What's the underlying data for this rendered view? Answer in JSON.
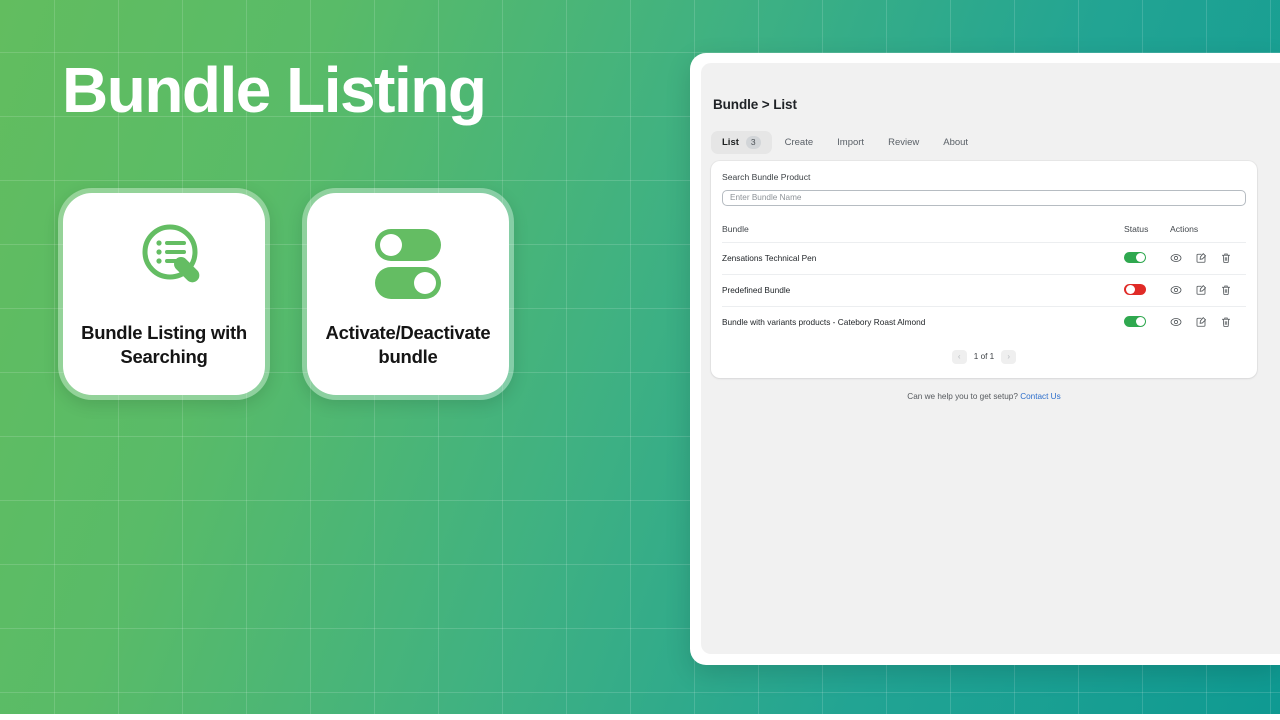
{
  "hero": {
    "title": "Bundle Listing"
  },
  "feature_cards": [
    {
      "icon": "magnifier-list-icon",
      "label": "Bundle Listing with Searching"
    },
    {
      "icon": "toggle-switches-icon",
      "label": "Activate/Deactivate bundle"
    }
  ],
  "app": {
    "breadcrumb": "Bundle > List",
    "tabs": [
      {
        "label": "List",
        "badge": "3",
        "active": true
      },
      {
        "label": "Create",
        "badge": "",
        "active": false
      },
      {
        "label": "Import",
        "badge": "",
        "active": false
      },
      {
        "label": "Review",
        "badge": "",
        "active": false
      },
      {
        "label": "About",
        "badge": "",
        "active": false
      }
    ],
    "search": {
      "label": "Search Bundle Product",
      "value": "",
      "placeholder": "Enter Bundle Name"
    },
    "table": {
      "headers": {
        "bundle": "Bundle",
        "status": "Status",
        "actions": "Actions"
      },
      "rows": [
        {
          "bundle": "Zensations Technical Pen",
          "status": "on",
          "actions": [
            "view-icon",
            "edit-icon",
            "delete-icon"
          ]
        },
        {
          "bundle": "Predefined Bundle",
          "status": "off",
          "actions": [
            "view-icon",
            "edit-icon",
            "delete-icon"
          ]
        },
        {
          "bundle": "Bundle with variants products - Catebory Roast Almond",
          "status": "on",
          "actions": [
            "view-icon",
            "edit-icon",
            "delete-icon"
          ]
        }
      ]
    },
    "pagination": {
      "prev": "‹",
      "label": "1 of 1",
      "next": "›"
    },
    "footer": {
      "help_text": "Can we help you to get setup?",
      "help_link": "Contact Us"
    }
  },
  "colors": {
    "bg_green": "#62bd5f",
    "bg_teal": "#0f9a92",
    "toggle_on": "#2fa84f",
    "toggle_off": "#e02b27",
    "link": "#2c6ecb",
    "tab_active_bg": "#e6e6e6"
  }
}
